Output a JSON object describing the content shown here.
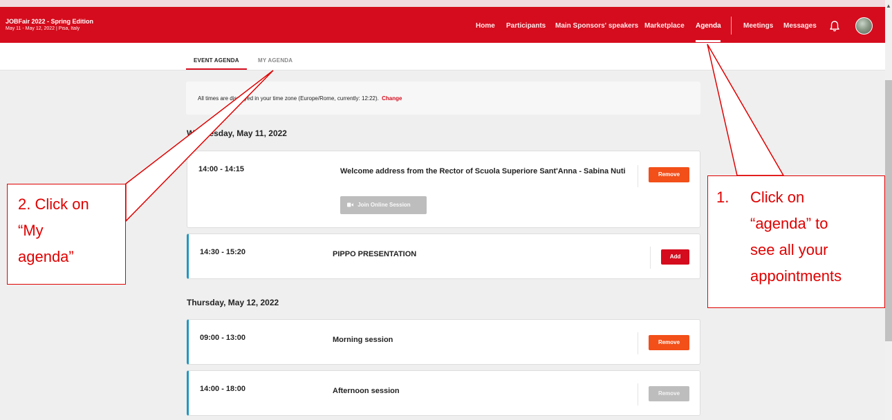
{
  "event": {
    "title": "JOBFair 2022 - Spring Edition",
    "subtitle": "May 11 - May 12, 2022 | Pisa, Italy"
  },
  "nav": {
    "items": [
      "Home",
      "Participants",
      "Main Sponsors' speakers",
      "Marketplace",
      "Agenda"
    ],
    "meetings": "Meetings",
    "messages": "Messages",
    "icons": {
      "bell": "bell-icon",
      "avatar": "user-avatar"
    }
  },
  "tabs": [
    "EVENT AGENDA",
    "MY AGENDA"
  ],
  "timezone": {
    "text": "All times are displayed in your time zone (Europe/Rome, currently: 12:22).",
    "link": "Change"
  },
  "days": [
    {
      "label": "Wednesday, May 11, 2022",
      "sessions": [
        {
          "time": "14:00 - 14:15",
          "title": "Welcome address from the Rector of Scuola Superiore Sant'Anna - Sabina Nuti",
          "button": "Remove",
          "join": "Join Online Session"
        },
        {
          "time": "14:30 - 15:20",
          "title": "PIPPO PRESENTATION",
          "button": "Add"
        }
      ]
    },
    {
      "label": "Thursday, May 12, 2022",
      "sessions": [
        {
          "time": "09:00 - 13:00",
          "title": "Morning session",
          "button": "Remove"
        },
        {
          "time": "14:00 - 18:00",
          "title": "Afternoon session",
          "button": "Remove"
        }
      ]
    }
  ],
  "annotations": {
    "left_lines": [
      "2. Click on",
      "“My",
      "agenda”"
    ],
    "right_number": "1.",
    "right_lines": [
      "Click on",
      "“agenda” to",
      "see all your",
      "appointments"
    ]
  },
  "colors": {
    "brand": "#d50c1d",
    "remove": "#f24f19",
    "accent": "#1f97c0",
    "annotation": "#e00000"
  }
}
